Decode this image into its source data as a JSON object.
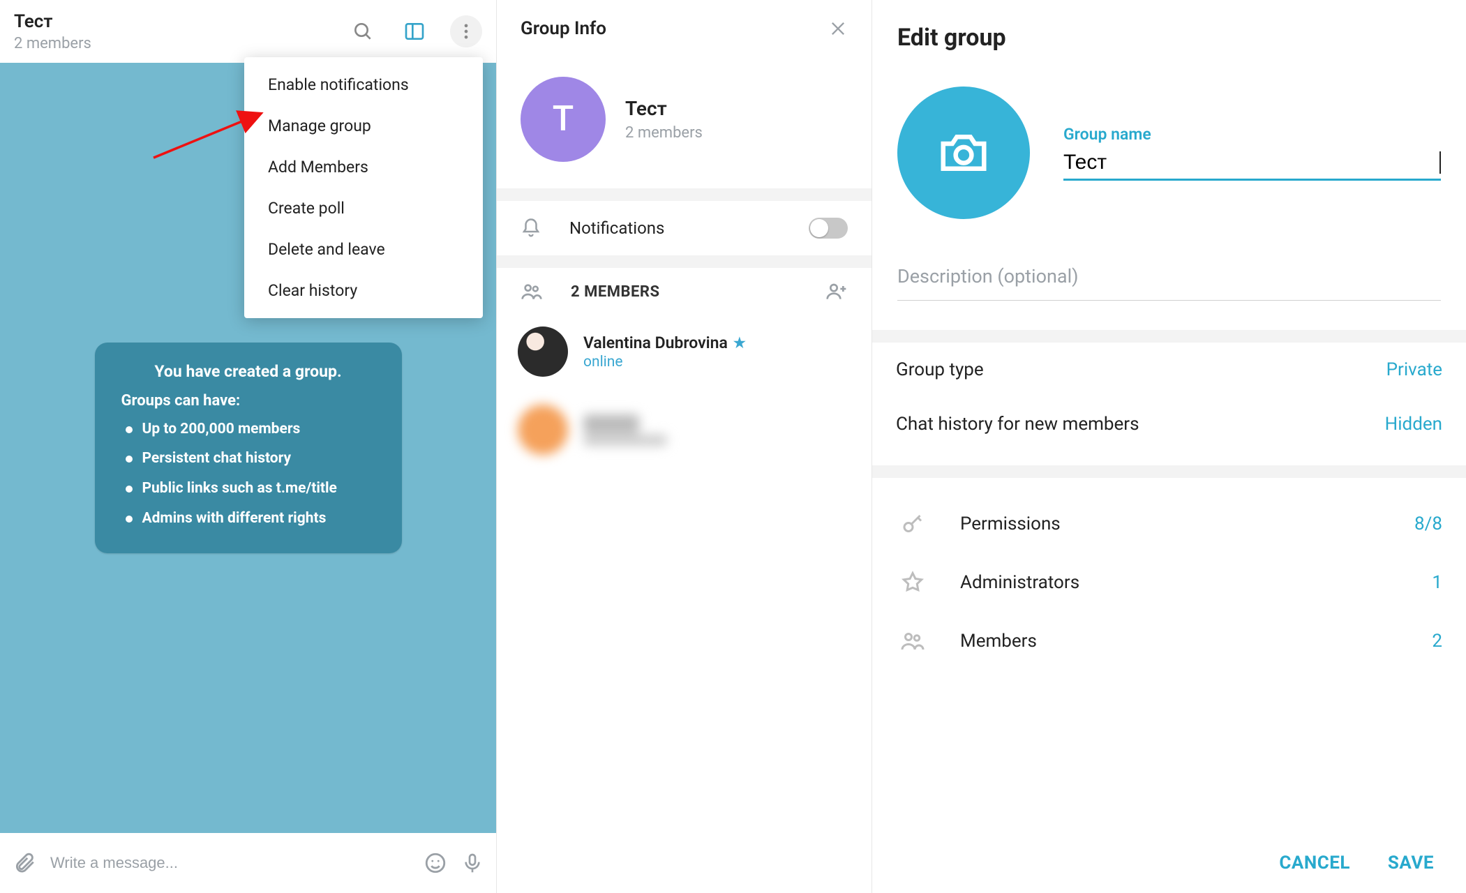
{
  "chat": {
    "title": "Тест",
    "subtitle": "2 members",
    "composer_placeholder": "Write a message...",
    "system_message": {
      "headline": "You have created a group.",
      "lead": "Groups can have:",
      "bullets": [
        "Up to 200,000 members",
        "Persistent chat history",
        "Public links such as t.me/title",
        "Admins with different rights"
      ]
    }
  },
  "dropdown": {
    "items": [
      "Enable notifications",
      "Manage group",
      "Add Members",
      "Create poll",
      "Delete and leave",
      "Clear history"
    ]
  },
  "group_info": {
    "header": "Group Info",
    "name": "Тест",
    "subtitle": "2 members",
    "avatar_letter": "T",
    "notifications_label": "Notifications",
    "notifications_on": false,
    "members_header": "2 MEMBERS",
    "members": [
      {
        "name": "Valentina Dubrovina",
        "status": "online",
        "star": true
      }
    ]
  },
  "edit_group": {
    "header": "Edit group",
    "group_name_label": "Group name",
    "group_name_value": "Тест",
    "description_placeholder": "Description (optional)",
    "settings": [
      {
        "label": "Group type",
        "value": "Private"
      },
      {
        "label": "Chat history for new members",
        "value": "Hidden"
      }
    ],
    "lists": [
      {
        "icon": "key",
        "label": "Permissions",
        "value": "8/8"
      },
      {
        "icon": "star",
        "label": "Administrators",
        "value": "1"
      },
      {
        "icon": "people",
        "label": "Members",
        "value": "2"
      }
    ],
    "cancel_label": "CANCEL",
    "save_label": "SAVE"
  },
  "colors": {
    "accent": "#28a9cd",
    "chat_bg": "#74b9cf",
    "avatar_purple": "#9f87e6"
  }
}
